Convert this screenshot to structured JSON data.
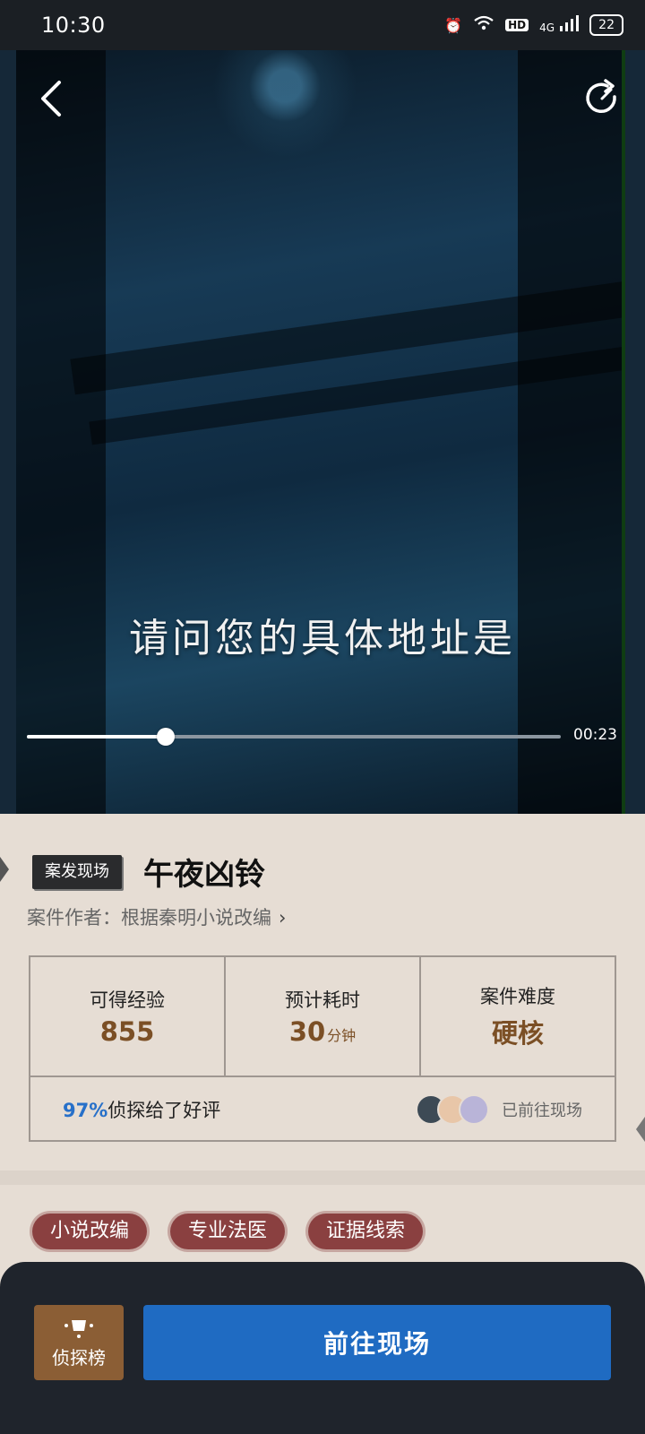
{
  "status_bar": {
    "time": "10:30",
    "hd_badge": "HD",
    "network": "4G",
    "battery": "22"
  },
  "video": {
    "subtitle": "请问您的具体地址是",
    "current_time": "00:23",
    "progress_fraction": 0.26
  },
  "case": {
    "tag": "案发现场",
    "title": "午夜凶铃",
    "author_line": "案件作者：根据秦明小说改编",
    "stats": [
      {
        "label": "可得经验",
        "value": "855",
        "unit": ""
      },
      {
        "label": "预计耗时",
        "value": "30",
        "unit": "分钟"
      },
      {
        "label": "案件难度",
        "value": "硬核",
        "unit": ""
      }
    ],
    "rating_percent": "97%",
    "rating_text": "侦探给了好评",
    "visited_text": "已前往现场"
  },
  "tags": [
    "小说改编",
    "专业法医",
    "证据线索"
  ],
  "actions": {
    "rank_label": "侦探榜",
    "go_label": "前往现场"
  }
}
